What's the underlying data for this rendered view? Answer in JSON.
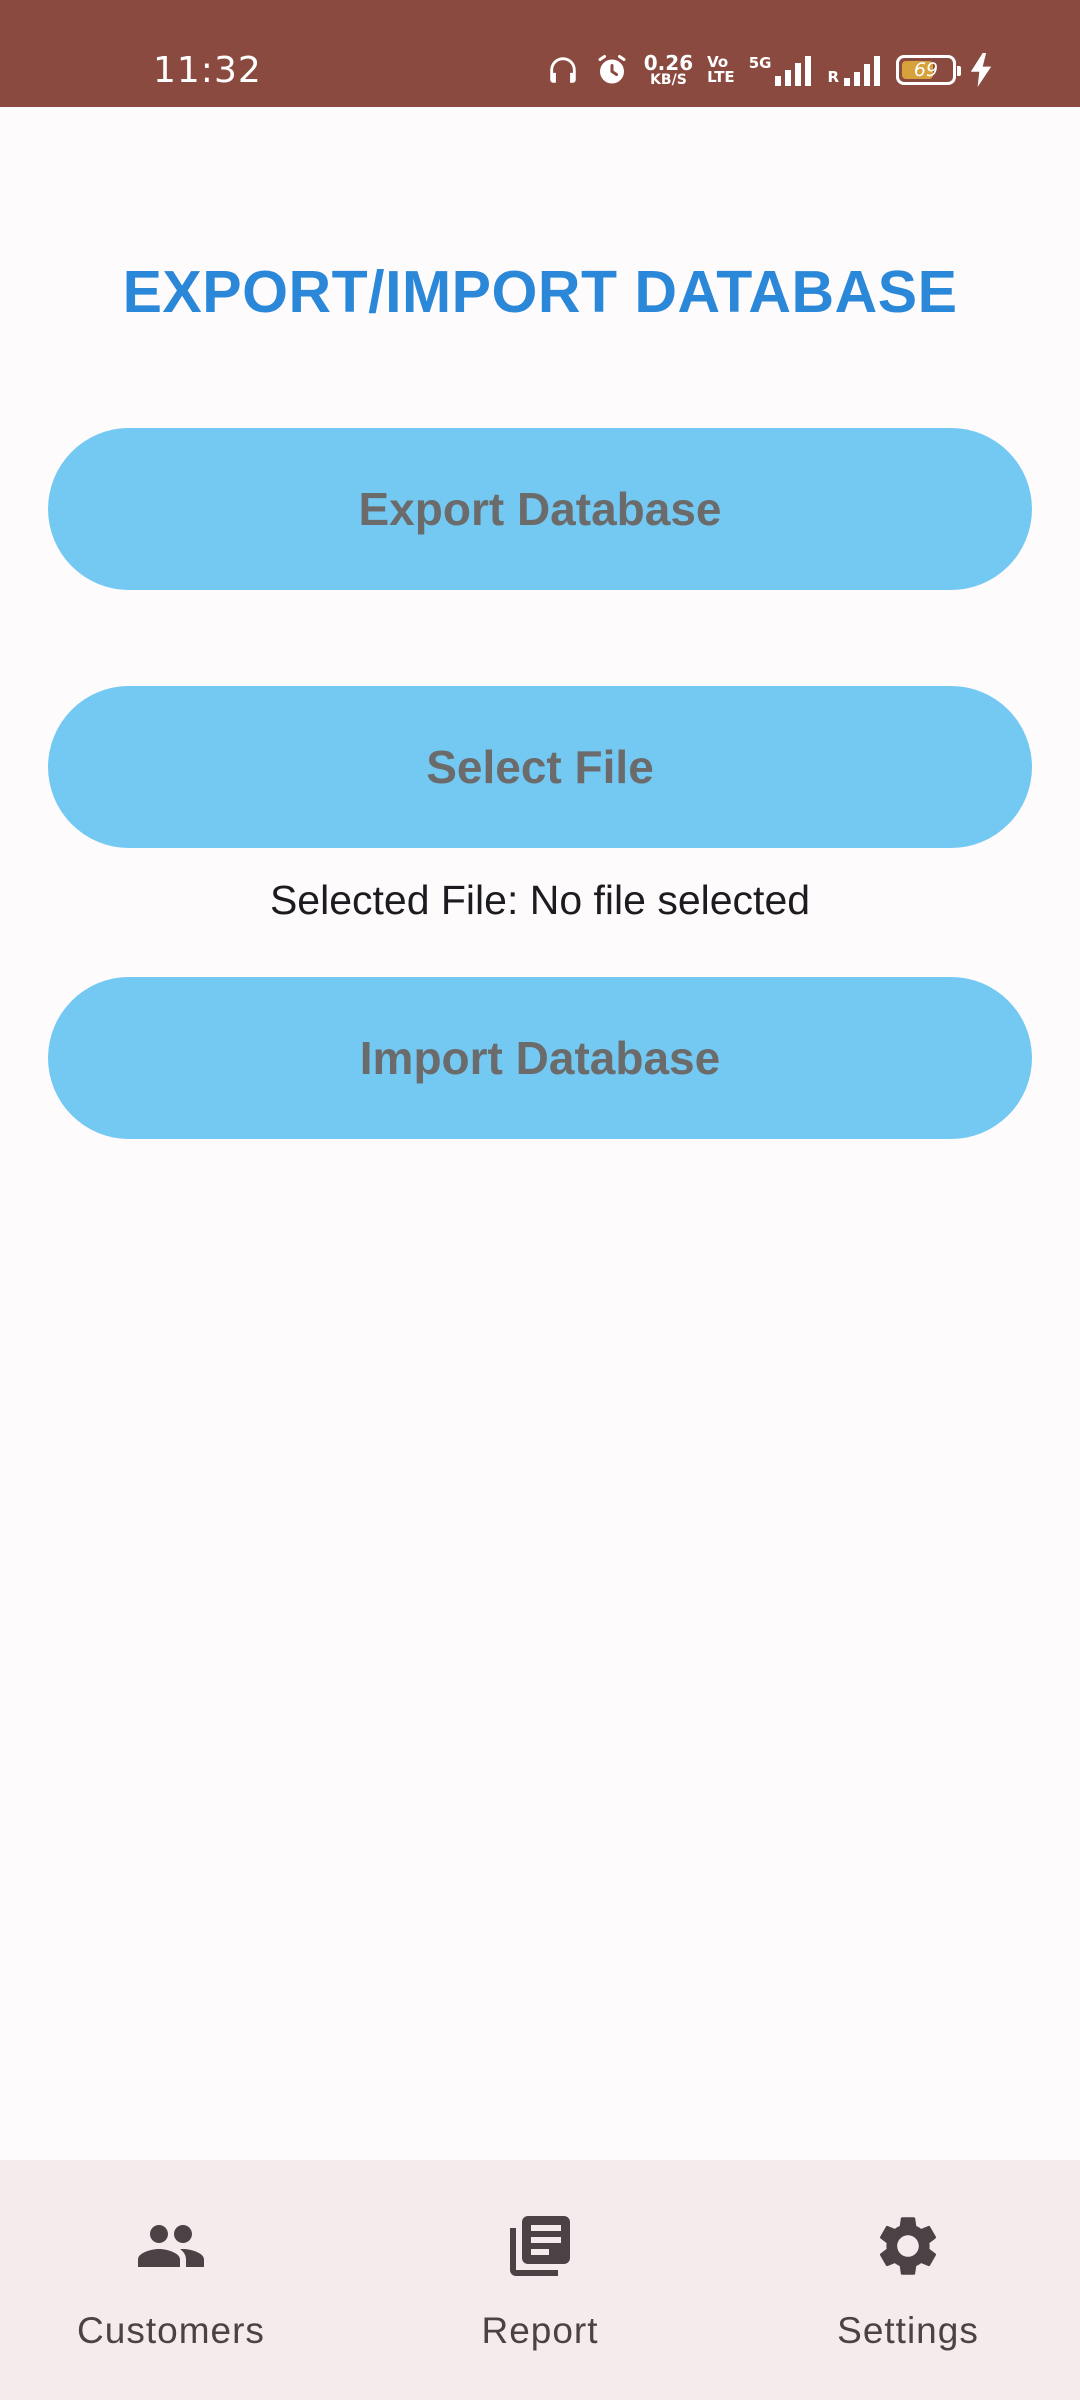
{
  "status_bar": {
    "time": "11:32",
    "net_speed_value": "0.26",
    "net_speed_unit": "KB/S",
    "volte_top": "Vo",
    "volte_bottom": "LTE",
    "network_type": "5G",
    "roaming": "R",
    "battery_level": "69",
    "battery_fill_percent": 69,
    "bar_color": "#8b4a40"
  },
  "main": {
    "title": "EXPORT/IMPORT DATABASE",
    "export_button": "Export Database",
    "select_button": "Select File",
    "selected_file_text": "Selected File: No file selected",
    "import_button": "Import Database",
    "title_color": "#2b88d8",
    "button_color": "#74c9f3"
  },
  "bottom_nav": {
    "items": [
      {
        "label": "Customers",
        "icon": "people-icon"
      },
      {
        "label": "Report",
        "icon": "report-stack-icon"
      },
      {
        "label": "Settings",
        "icon": "gear-icon"
      }
    ]
  }
}
